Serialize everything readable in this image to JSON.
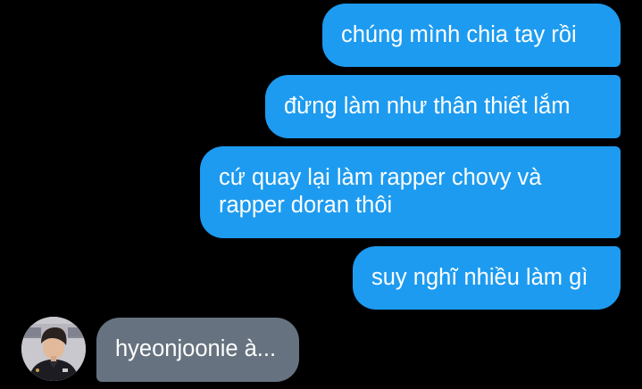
{
  "conversation": {
    "sent_messages": [
      {
        "text": "chúng mình chia tay rồi"
      },
      {
        "text": "đừng làm như thân thiết lắm"
      },
      {
        "text": "cứ quay lại làm rapper chovy và rapper doran thôi"
      },
      {
        "text": "suy nghĩ nhiều làm gì"
      }
    ],
    "received_messages": [
      {
        "text": "hyeonjoonie à..."
      }
    ]
  },
  "colors": {
    "background": "#000000",
    "sent_bubble": "#1d9bf0",
    "received_bubble": "#66727f",
    "text": "#ffffff"
  }
}
